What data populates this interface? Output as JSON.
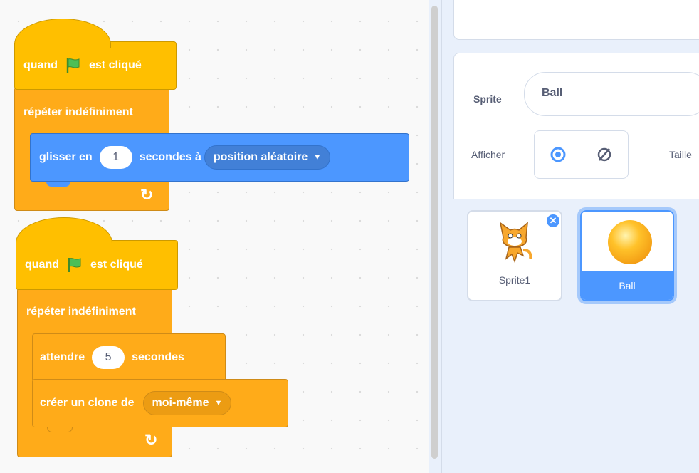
{
  "script1": {
    "hat": {
      "before": "quand",
      "after": "est cliqué",
      "icon": "green-flag-icon"
    },
    "forever_label": "répéter indéfiniment",
    "glide": {
      "before": "glisser en",
      "secs": "1",
      "middle": "secondes à",
      "target": "position aléatoire"
    }
  },
  "script2": {
    "hat": {
      "before": "quand",
      "after": "est cliqué",
      "icon": "green-flag-icon"
    },
    "forever_label": "répéter indéfiniment",
    "wait": {
      "before": "attendre",
      "secs": "5",
      "after": "secondes"
    },
    "clone": {
      "before": "créer un clone de",
      "target": "moi-même"
    }
  },
  "sprite_info": {
    "sprite_label": "Sprite",
    "sprite_name": "Ball",
    "show_label": "Afficher",
    "size_label": "Taille"
  },
  "sprites": [
    {
      "name": "Sprite1",
      "selected": false
    },
    {
      "name": "Ball",
      "selected": true
    }
  ],
  "colors": {
    "events": "#ffbf00",
    "control": "#ffab19",
    "motion": "#4c97ff",
    "selected": "#4c97ff"
  }
}
